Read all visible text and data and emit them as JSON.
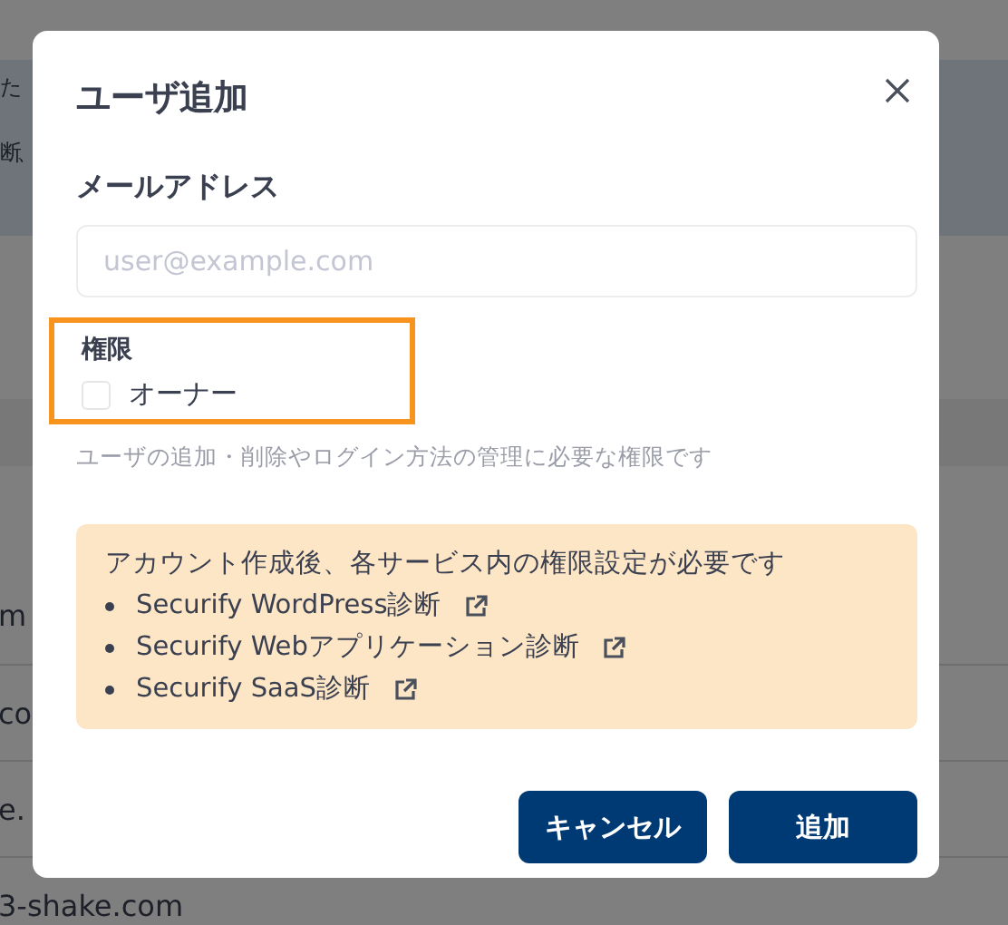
{
  "background": {
    "banner_lines": [
      "た",
      "断、"
    ],
    "rows": [
      "m",
      "co",
      "e.",
      "3-shake.com"
    ]
  },
  "dialog": {
    "title": "ユーザ追加",
    "email": {
      "label": "メールアドレス",
      "placeholder": "user@example.com"
    },
    "permission": {
      "label": "権限",
      "highlighted": true,
      "options": [
        {
          "label": "オーナー",
          "checked": false
        }
      ],
      "help": "ユーザの追加・削除やログイン方法の管理に必要な権限です"
    },
    "notice": {
      "text": "アカウント作成後、各サービス内の権限設定が必要です",
      "links": [
        "Securify WordPress診断",
        "Securify Webアプリケーション診断",
        "Securify SaaS診断"
      ]
    },
    "buttons": [
      {
        "label": "キャンセル"
      },
      {
        "label": "追加"
      }
    ]
  }
}
